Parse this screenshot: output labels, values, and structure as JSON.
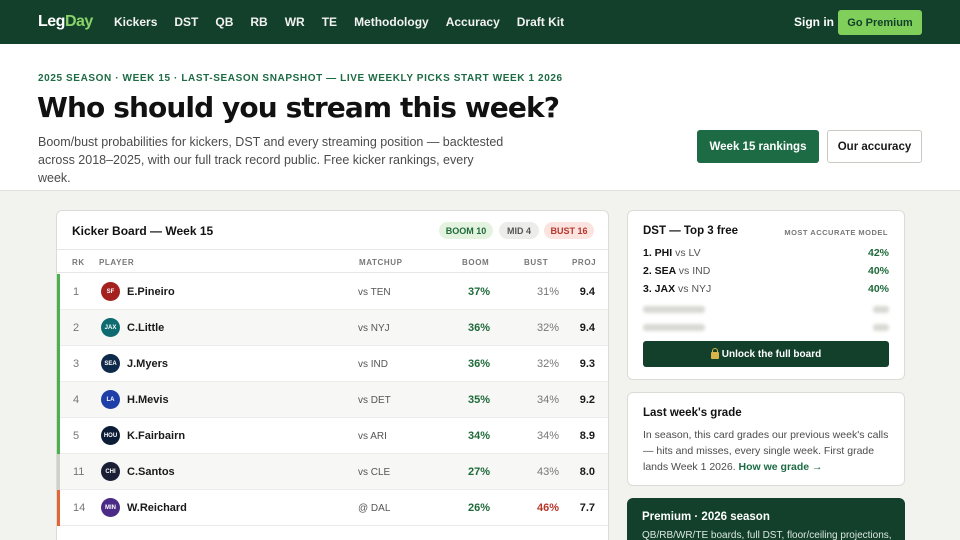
{
  "nav": {
    "logo_part1": "Leg",
    "logo_part2": "Day",
    "links": [
      "Kickers",
      "DST",
      "QB",
      "RB",
      "WR",
      "TE",
      "Methodology",
      "Accuracy",
      "Draft Kit"
    ],
    "signin": "Sign in",
    "premium_button": "Go Premium"
  },
  "hero": {
    "eyebrow": "2025 SEASON · WEEK 15 · LAST-SEASON SNAPSHOT — LIVE WEEKLY PICKS START WEEK 1 2026",
    "headline": "Who should you stream this week?",
    "subtitle": "Boom/bust probabilities for kickers, DST and every streaming position — backtested across 2018–2025, with our full track record public. Free kicker rankings, every week.",
    "primary_button": "Week 15 rankings",
    "secondary_button": "Our accuracy"
  },
  "board": {
    "title": "Kicker Board — Week 15",
    "badges": {
      "boom": "BOOM 10",
      "mid": "MID 4",
      "bust": "BUST 16"
    },
    "columns": {
      "rank": "RK",
      "player": "PLAYER",
      "matchup": "MATCHUP",
      "boom": "BOOM",
      "bust": "BUST",
      "proj": "PROJ"
    },
    "rows": [
      {
        "rank": "1",
        "team": "SF",
        "team_color": "#a5211f",
        "player": "E.Pineiro",
        "matchup": "vs TEN",
        "boom": "37%",
        "bust": "31%",
        "proj": "9.4",
        "tier": "boom"
      },
      {
        "rank": "2",
        "team": "JAX",
        "team_color": "#0e6b70",
        "player": "C.Little",
        "matchup": "vs NYJ",
        "boom": "36%",
        "bust": "32%",
        "proj": "9.4",
        "tier": "boom"
      },
      {
        "rank": "3",
        "team": "SEA",
        "team_color": "#0d2a4a",
        "player": "J.Myers",
        "matchup": "vs IND",
        "boom": "36%",
        "bust": "32%",
        "proj": "9.3",
        "tier": "boom"
      },
      {
        "rank": "4",
        "team": "LA",
        "team_color": "#1f3fa8",
        "player": "H.Mevis",
        "matchup": "vs DET",
        "boom": "35%",
        "bust": "34%",
        "proj": "9.2",
        "tier": "boom"
      },
      {
        "rank": "5",
        "team": "HOU",
        "team_color": "#0b1d36",
        "player": "K.Fairbairn",
        "matchup": "vs ARI",
        "boom": "34%",
        "bust": "34%",
        "proj": "8.9",
        "tier": "boom"
      },
      {
        "rank": "11",
        "team": "CHI",
        "team_color": "#1a1f36",
        "player": "C.Santos",
        "matchup": "vs CLE",
        "boom": "27%",
        "bust": "43%",
        "proj": "8.0",
        "tier": "mid"
      },
      {
        "rank": "14",
        "team": "MIN",
        "team_color": "#4a2b86",
        "player": "W.Reichard",
        "matchup": "@ DAL",
        "boom": "26%",
        "bust": "46%",
        "proj": "7.7",
        "tier": "bust"
      }
    ]
  },
  "dst": {
    "title": "DST — Top 3 free",
    "tag": "MOST ACCURATE MODEL",
    "rows": [
      {
        "team": "1. PHI",
        "opp": "vs LV",
        "pct": "42%"
      },
      {
        "team": "2. SEA",
        "opp": "vs IND",
        "pct": "40%"
      },
      {
        "team": "3. JAX",
        "opp": "vs NYJ",
        "pct": "40%"
      }
    ],
    "unlock": "Unlock the full board"
  },
  "grade": {
    "title": "Last week's grade",
    "text": "In season, this card grades our previous week's calls — hits and misses, every single week. First grade lands Week 1 2026.",
    "link": "How we grade →"
  },
  "premium_card": {
    "title": "Premium · 2026 season",
    "text": "QB/RB/WR/TE boards, full DST, floor/ceiling projections,"
  },
  "colors": {
    "nav_bg": "#13402b",
    "accent": "#1d6b44",
    "premium": "#7fcf5a",
    "boom": "#1f6a3a",
    "bust": "#b8352a",
    "tier_boom": "#4caf50",
    "tier_mid": "#cfcfcb",
    "tier_bust": "#e0663a"
  }
}
